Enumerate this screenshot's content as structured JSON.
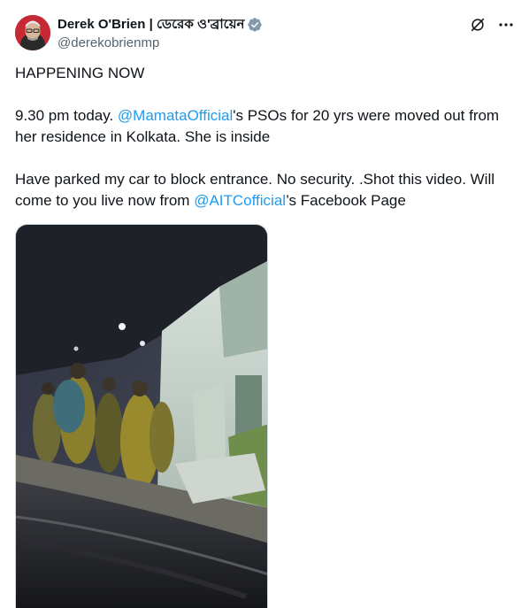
{
  "author": {
    "display_name": "Derek O'Brien | ডেরেক ও'ব্রায়েন",
    "handle": "@derekobrienmp",
    "verified": true
  },
  "colors": {
    "link": "#1d9bf0",
    "verified_badge": "#829aab",
    "text": "#0f1419",
    "secondary": "#536471"
  },
  "icons": {
    "grok": "grok-icon",
    "more": "more-icon",
    "verified": "verified-badge-icon"
  },
  "tweet": {
    "line1": "HAPPENING NOW",
    "line2_pre": "9.30 pm today. ",
    "line2_mention": "@MamataOfficial",
    "line2_post": "'s PSOs for 20 yrs were moved out from her residence in Kolkata. She is inside",
    "line3_pre": "Have parked my car to block entrance. No security. .Shot this video. Will come to you live now from ",
    "line3_mention": "@AITCofficial",
    "line3_post": "’s Facebook Page"
  }
}
